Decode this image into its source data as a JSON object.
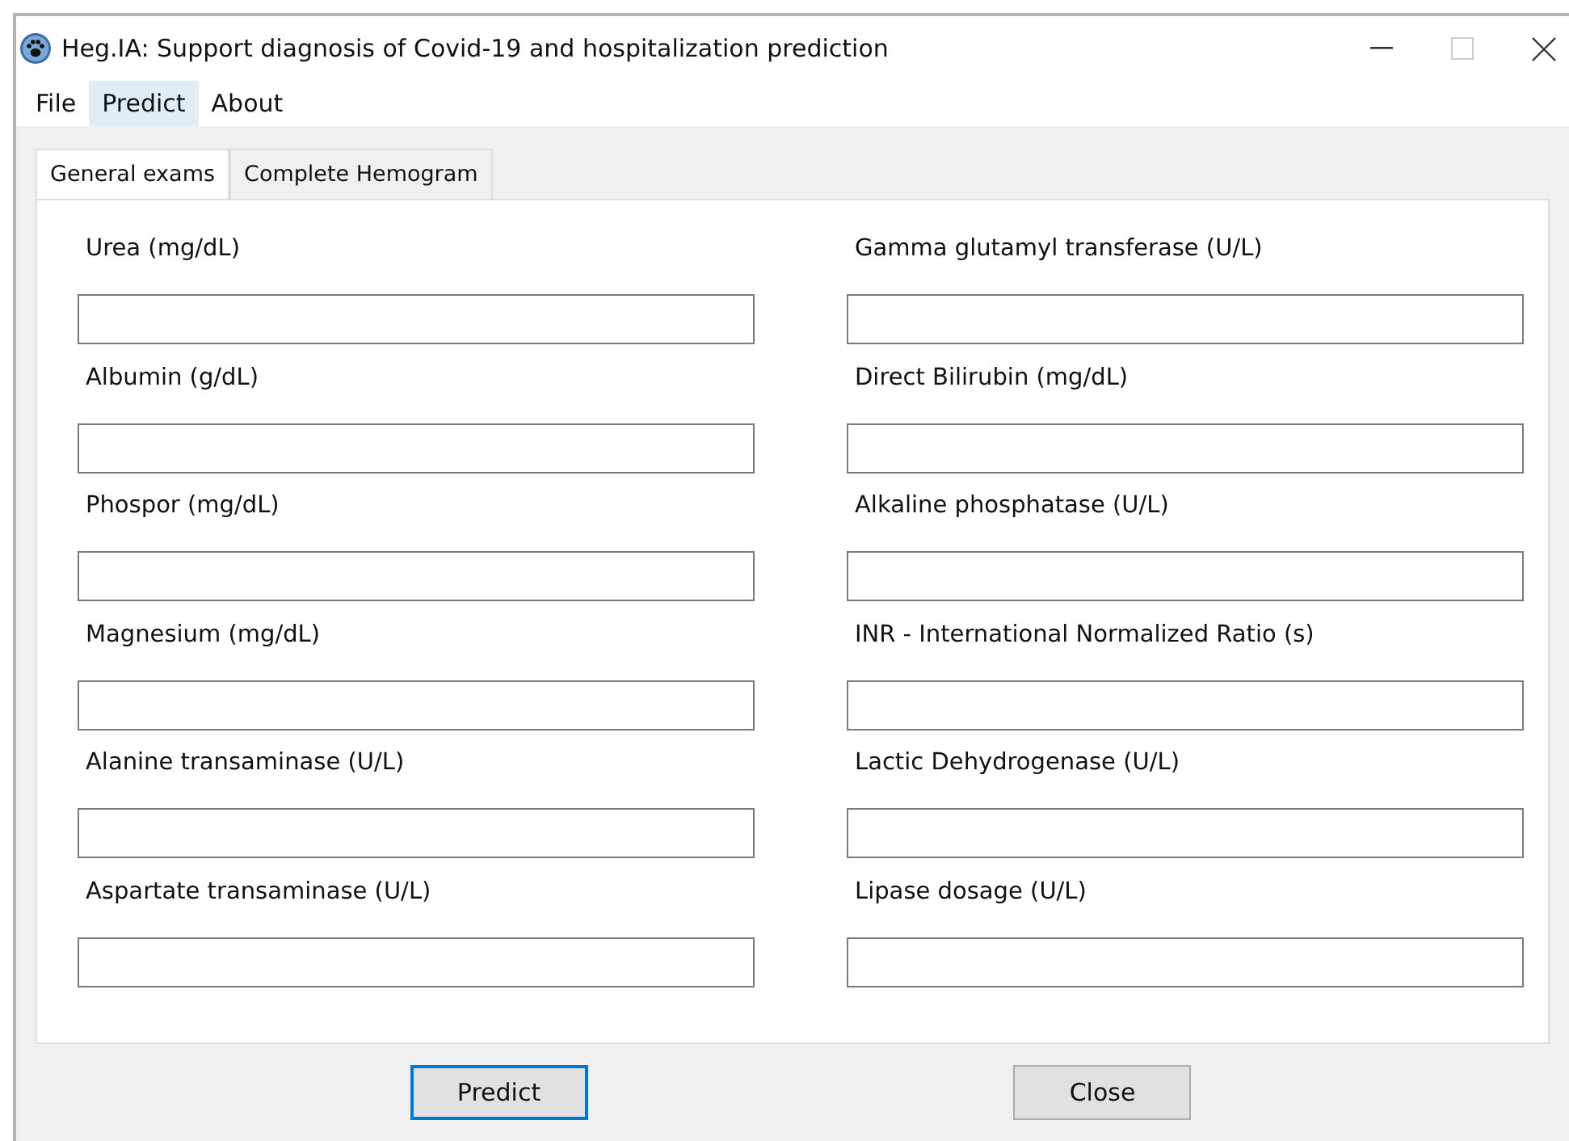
{
  "window": {
    "title": "Heg.IA:  Support diagnosis of Covid-19 and hospitalization prediction"
  },
  "menu": [
    {
      "label": "File",
      "selected": false
    },
    {
      "label": "Predict",
      "selected": true
    },
    {
      "label": "About",
      "selected": false
    }
  ],
  "tabs": [
    {
      "label": "General exams",
      "selected": true
    },
    {
      "label": "Complete Hemogram",
      "selected": false
    }
  ],
  "fields": [
    {
      "label": "Urea (mg/dL)"
    },
    {
      "label": "Gamma glutamyl transferase (U/L)"
    },
    {
      "label": "Albumin (g/dL)"
    },
    {
      "label": "Direct Bilirubin (mg/dL)"
    },
    {
      "label": "Phospor (mg/dL)"
    },
    {
      "label": "Alkaline phosphatase (U/L)"
    },
    {
      "label": "Magnesium (mg/dL)"
    },
    {
      "label": "INR - International Normalized Ratio (s)"
    },
    {
      "label": "Alanine transaminase (U/L)"
    },
    {
      "label": "Lactic Dehydrogenase (U/L)"
    },
    {
      "label": "Aspartate transaminase (U/L)"
    },
    {
      "label": "Lipase dosage (U/L)"
    }
  ],
  "buttons": [
    {
      "label": "Predict",
      "focused": true
    },
    {
      "label": "Close",
      "focused": false
    }
  ]
}
